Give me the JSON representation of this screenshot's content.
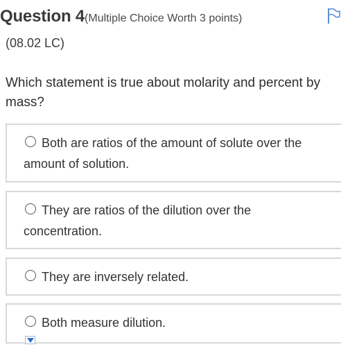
{
  "question": {
    "title": "Question 4",
    "meta": "(Multiple Choice Worth 3 points)",
    "code": "(08.02 LC)",
    "prompt": "Which statement is true about molarity and percent by mass?"
  },
  "options": [
    {
      "label": "Both are ratios of the amount of solute over the amount of solution.",
      "selected": false
    },
    {
      "label": "They are ratios of the dilution over the concentration.",
      "selected": false
    },
    {
      "label": "They are inversely related.",
      "selected": false
    },
    {
      "label": "Both measure dilution.",
      "selected": false
    }
  ],
  "icons": {
    "flag": "flag-icon",
    "radio": "radio-unselected-icon",
    "scroll": "chevron-down-icon"
  },
  "colors": {
    "text": "#333333",
    "border": "#d7d7d7",
    "flag": "#5a8fd8",
    "caret": "#2f6fc4"
  }
}
